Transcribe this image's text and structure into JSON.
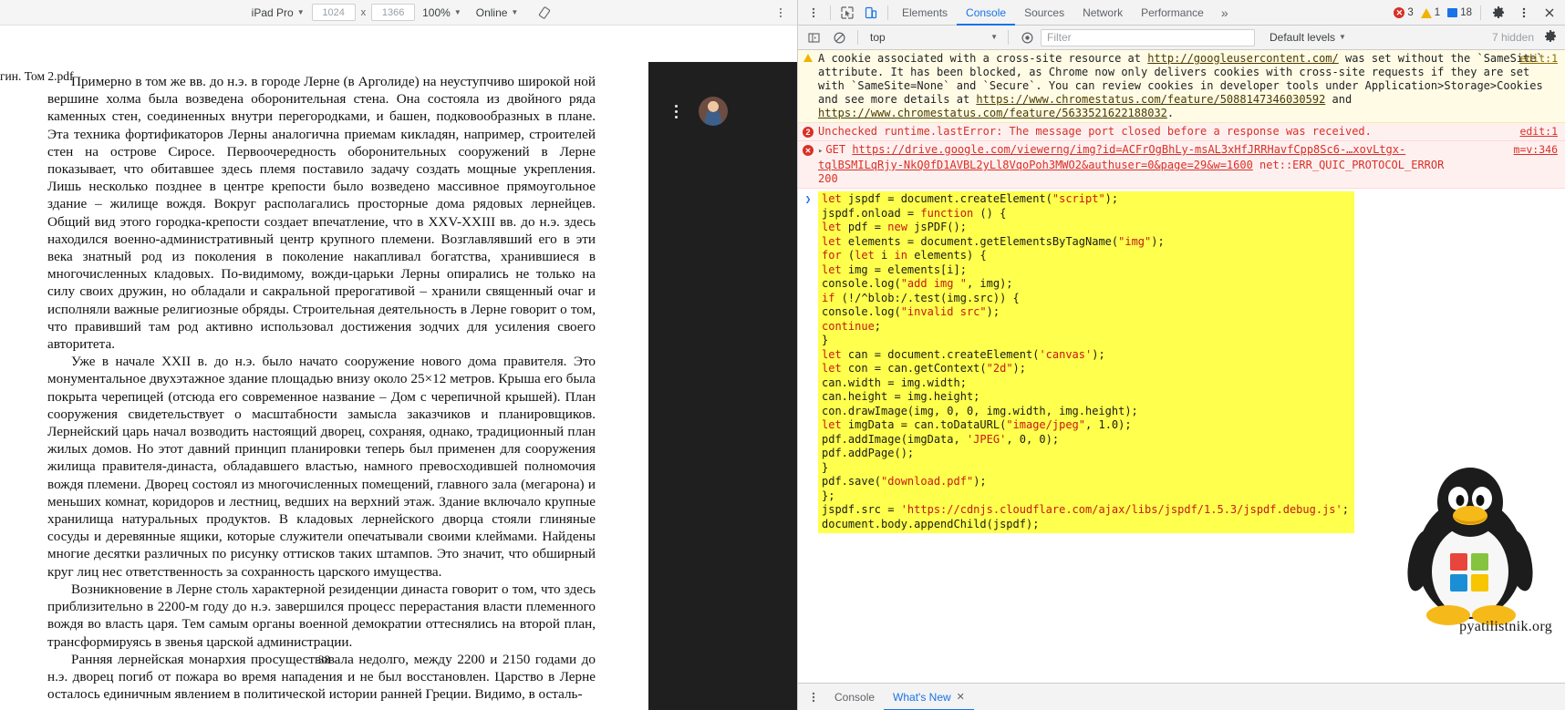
{
  "device_toolbar": {
    "device_label": "iPad Pro",
    "width": "1024",
    "height": "1366",
    "zoom": "100%",
    "throttling": "Online",
    "rotate_icon": "rotate-icon",
    "kebab_icon": "more-options-icon",
    "x_separator": "x"
  },
  "document": {
    "clipped_tab_label": "гин. Том 2.pdf",
    "page_number": "38",
    "paragraphs": [
      "Примерно в том же вв. до н.э. в городе Лерне (в Арголиде) на неуступчиво широкой ной вершине холма была возведена оборонительная стена.  Она состояла из двойного ряда каменных стен, соединенных внутри перегородками, и башен, подковообразных в плане. Эта техника фортификаторов Лерны аналогична приемам кикладян, например, строителей стен на острове Сиросе. Первоочередность оборонительных сооружений в Лерне показывает, что обитавшее здесь племя поставило задачу создать мощные укрепления. Лишь несколько позднее в центре крепости было возведено массивное прямоугольное здание – жилище вождя. Вокруг располагались просторные дома рядовых лернейцев. Общий вид этого городка-крепости создает впечатление, что в XXV-XXIII вв. до н.э. здесь находился военно-административный центр крупного племени. Возглавлявший его в эти века знатный род из поколения в поколение накапливал богатства, хранившиеся в многочисленных кладовых. По-видимому, вожди-царьки Лерны опирались не только на силу своих дружин, но обладали и сакральной прерогативой – хранили священный очаг и исполняли важные религиозные обряды. Строительная деятельность в Лерне говорит о том, что правивший там род активно использовал достижения зодчих для усиления своего авторитета.",
      "Уже в начале XXII в. до н.э. было начато сооружение нового дома правителя. Это монументальное двухэтажное здание площадью внизу около 25×12 метров. Крыша его была покрыта черепицей (отсюда его современное название – Дом с черепичной крышей). План сооружения свидетельствует о масштабности замысла заказчиков и планировщиков. Лернейский царь начал возводить настоящий дворец, сохраняя, однако, традиционный план жилых домов. Но этот давний принцип планировки теперь был применен для сооружения жилища правителя-династа, обладавшего властью, намного превосходившей полномочия вождя племени. Дворец состоял из многочисленных помещений, главного зала (мегарона) и меньших комнат, коридоров и лестниц, ведших на верхний этаж. Здание включало крупные хранилища натуральных продуктов. В кладовых лернейского дворца стояли глиняные сосуды и деревянные ящики, которые служители опечатывали своими клеймами. Найдены многие десятки различных по рисунку оттисков таких штампов. Это значит, что обширный круг лиц нес ответственность за сохранность царского имущества.",
      "Возникновение в Лерне столь характерной резиденции династа говорит о том, что здесь приблизительно в 2200-м году до н.э. завершился процесс перерастания власти племенного вождя во власть царя. Тем самым органы военной демократии оттеснялись на второй план, трансформируясь в звенья царской администрации.",
      "Ранняя лернейская монархия просуществовала недолго, между 2200 и 2150 годами до н.э. дворец погиб от пожара во время нападения и не был восстановлен. Царство в Лерне осталось единичным явлением в политической истории ранней Греции. Видимо, в осталь-"
    ]
  },
  "devtools": {
    "inspect_icon": "inspect-element-icon",
    "device_toggle_icon": "toggle-device-toolbar-icon",
    "tabs": [
      {
        "label": "Elements",
        "active": false
      },
      {
        "label": "Console",
        "active": true
      },
      {
        "label": "Sources",
        "active": false
      },
      {
        "label": "Network",
        "active": false
      },
      {
        "label": "Performance",
        "active": false
      }
    ],
    "more_tabs_icon": "chevron-double-right-icon",
    "counters": {
      "errors": "3",
      "warnings": "1",
      "info": "18"
    },
    "settings_icon": "gear-icon",
    "main_menu_icon": "more-options-icon",
    "close_icon": "close-icon",
    "left_kebab_icon": "more-options-icon"
  },
  "console_toolbar": {
    "sidebar_icon": "console-sidebar-icon",
    "clear_icon": "clear-console-icon",
    "context": "top",
    "eye_icon": "live-expression-icon",
    "filter_placeholder": "Filter",
    "filter_value": "",
    "levels": "Default levels",
    "hidden_text": "7 hidden",
    "settings_icon": "gear-icon"
  },
  "console_messages": [
    {
      "type": "warning",
      "icon": "warning-triangle-icon",
      "source": "edit:1",
      "segments": [
        {
          "t": "A cookie associated with a cross-site resource at ",
          "link": false
        },
        {
          "t": "http://googleusercontent.com/",
          "link": true
        },
        {
          "t": " was set without the `SameSite` attribute. It has been blocked, as Chrome now only delivers cookies with cross-site requests if they are set with `SameSite=None` and `Secure`. You can review cookies in developer tools under Application>Storage>Cookies and see more details at ",
          "link": false
        },
        {
          "t": "https://www.chromestatus.com/feature/5088147346030592",
          "link": true
        },
        {
          "t": " and ",
          "link": false
        },
        {
          "t": "https://www.chromestatus.com/feature/5633521622188032",
          "link": true
        },
        {
          "t": ".",
          "link": false
        }
      ]
    },
    {
      "type": "error",
      "icon": "error-count-badge-icon",
      "count": "2",
      "source": "edit:1",
      "segments": [
        {
          "t": "Unchecked runtime.lastError: The message port closed before a response was received.",
          "link": false
        }
      ]
    },
    {
      "type": "error",
      "icon": "error-circle-icon",
      "source": "m=v:346",
      "disclosure": "▸",
      "segments": [
        {
          "t": "GET ",
          "link": false
        },
        {
          "t": "https://drive.google.com/viewerng/img?id=ACFrOgBhLy-msAL3xHfJRRHavfCpp8Sc6-…xovLtgx-",
          "link": true
        },
        {
          "t": "\n",
          "link": false
        },
        {
          "t": "tqlBSMILqRjy-NkQ0fD1AVBL2yLl8VqoPoh3MWO2&authuser=0&page=29&w=1600",
          "link": true
        },
        {
          "t": " net::ERR_QUIC_PROTOCOL_ERROR",
          "link": false
        },
        {
          "t": "\n200",
          "link": false
        }
      ]
    }
  ],
  "console_code_block": {
    "arrow_icon": "expand-arrow-icon",
    "lines": [
      "let jspdf = document.createElement(\"script\");",
      "jspdf.onload = function () {",
      "let pdf = new jsPDF();",
      "let elements = document.getElementsByTagName(\"img\");",
      "for (let i in elements) {",
      "let img = elements[i];",
      "console.log(\"add img \", img);",
      "if (!/^blob:/.test(img.src)) {",
      "console.log(\"invalid src\");",
      "continue;",
      "}",
      "let can = document.createElement('canvas');",
      "let con = can.getContext(\"2d\");",
      "can.width = img.width;",
      "can.height = img.height;",
      "con.drawImage(img, 0, 0, img.width, img.height);",
      "let imgData = can.toDataURL(\"image/jpeg\", 1.0);",
      "pdf.addImage(imgData, 'JPEG', 0, 0);",
      "pdf.addPage();",
      "}",
      "pdf.save(\"download.pdf\");",
      "};",
      "jspdf.src = 'https://cdnjs.cloudflare.com/ajax/libs/jspdf/1.5.3/jspdf.debug.js';",
      "document.body.appendChild(jspdf);"
    ]
  },
  "drawer": {
    "kebab_icon": "more-options-icon",
    "tabs": [
      {
        "label": "Console",
        "active": false,
        "closable": false
      },
      {
        "label": "What's New",
        "active": true,
        "closable": true
      }
    ],
    "close_glyph": "✕"
  },
  "watermark": {
    "caption": "pyatilistnik.org",
    "penguin_icon": "linux-penguin-icon",
    "windows_icon": "windows-logo-icon"
  },
  "colors": {
    "accent": "#1a73e8",
    "error": "#d93025",
    "warning": "#f0b400",
    "code_highlight": "#ffff4d",
    "toolbar_bg": "#f3f3f3"
  }
}
